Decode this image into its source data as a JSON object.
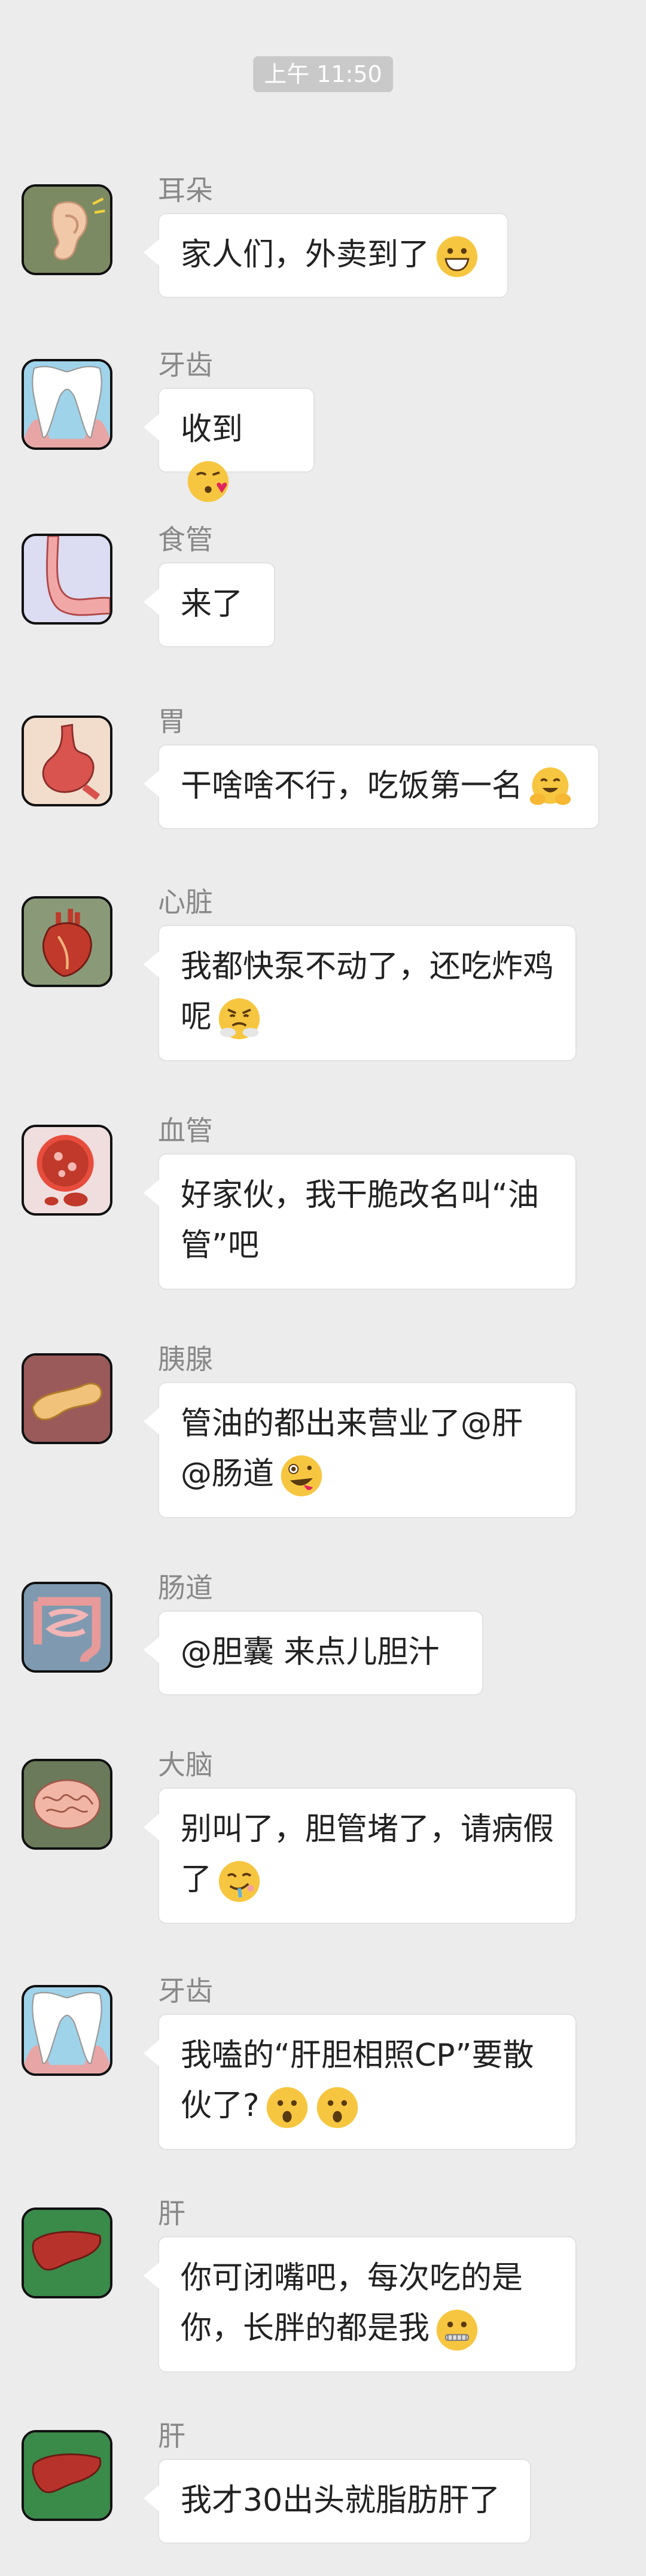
{
  "timestamp": "上午 11:50",
  "messages": [
    {
      "sender": "耳朵",
      "text": "家人们，外卖到了",
      "emoji": "grinning-face-icon"
    },
    {
      "sender": "牙齿",
      "text": "收到",
      "emoji": "kissing-face-icon"
    },
    {
      "sender": "食管",
      "text": "来了",
      "emoji": ""
    },
    {
      "sender": "胃",
      "text": "干啥啥不行，吃饭第一名",
      "emoji": "hugging-face-icon"
    },
    {
      "sender": "心脏",
      "text": "我都快泵不动了，还吃炸鸡呢",
      "emoji": "steam-from-nose-face-icon"
    },
    {
      "sender": "血管",
      "text": "好家伙，我干脆改名叫“油管”吧",
      "emoji": ""
    },
    {
      "sender": "胰腺",
      "text": "管油的都出来营业了@肝 @肠道",
      "emoji": "zany-face-icon"
    },
    {
      "sender": "肠道",
      "text": "@胆囊 来点儿胆汁",
      "emoji": ""
    },
    {
      "sender": "大脑",
      "text": "别叫了，胆管堵了，请病假了",
      "emoji": "drooling-face-icon"
    },
    {
      "sender": "牙齿",
      "text": "我嗑的“肝胆相照CP”要散伙了?",
      "emoji": "anguished-face-icon"
    },
    {
      "sender": "肝",
      "text": "你可闭嘴吧，每次吃的是你，长胖的都是我",
      "emoji": "zipper-mouth-face-icon"
    },
    {
      "sender": "肝",
      "text": "我才30出头就脂肪肝了",
      "emoji": ""
    }
  ]
}
